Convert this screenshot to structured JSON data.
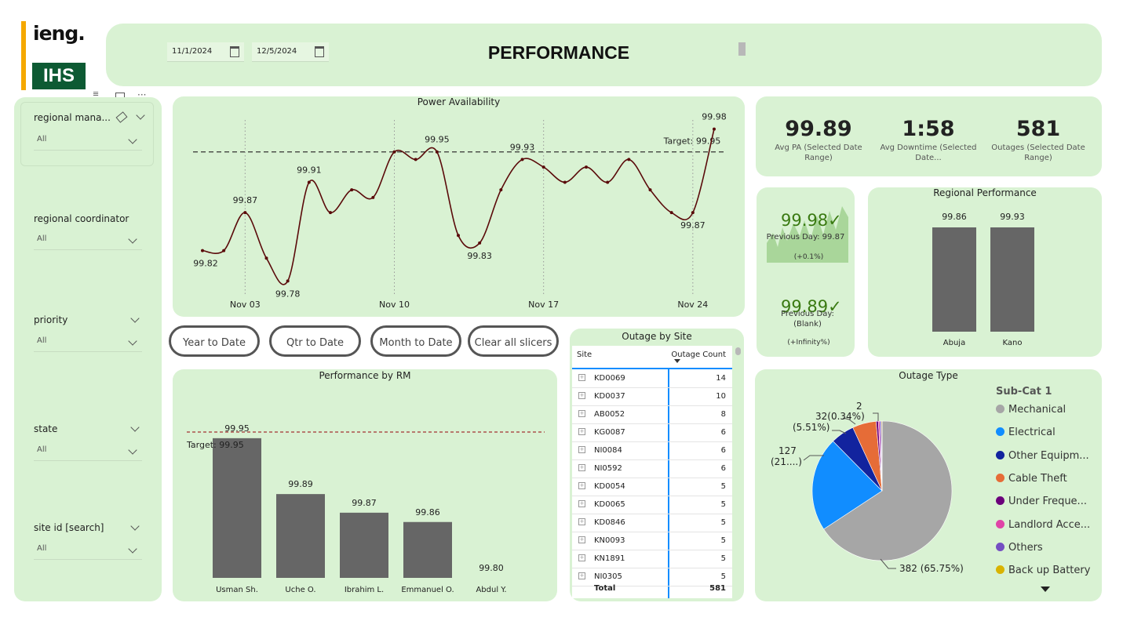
{
  "header": {
    "logo_top": "ieng.",
    "logo_bottom": "IHS",
    "title": "PERFORMANCE",
    "date_from": "11/1/2024",
    "date_to": "12/5/2024"
  },
  "slicers": [
    {
      "label": "regional mana...",
      "value": "All"
    },
    {
      "label": "regional coordinator",
      "value": "All"
    },
    {
      "label": "priority",
      "value": "All"
    },
    {
      "label": "state",
      "value": "All"
    },
    {
      "label": "site id [search]",
      "value": "All"
    }
  ],
  "buttons": {
    "ytd": "Year to Date",
    "qtd": "Qtr to Date",
    "mtd": "Month to Date",
    "clear": "Clear all slicers"
  },
  "kpis": [
    {
      "value": "99.89",
      "label": "Avg PA (Selected Date Range)"
    },
    {
      "value": "1:58",
      "label": "Avg Downtime (Selected Date..."
    },
    {
      "value": "581",
      "label": "Outages (Selected Date Range)"
    }
  ],
  "daily_cards": [
    {
      "value": "99.98✓",
      "prev": "Previous Day: 99.87",
      "delta": "(+0.1%)"
    },
    {
      "value": "99.89✓",
      "prev": "Previous Day: (Blank)",
      "delta": "(+Infinity%)"
    }
  ],
  "colors": {
    "panel_bg": "#d9f2d3",
    "bar": "#666666",
    "line": "#5a0a0a",
    "target_line_pa": "#333333",
    "target_line_rm": "#a33333",
    "kpi_positive": "#3a7a12"
  },
  "chart_data": [
    {
      "type": "line",
      "title": "Power Availability",
      "x_ticks": [
        "Nov 03",
        "Nov 10",
        "Nov 17",
        "Nov 24"
      ],
      "target_label": "Target: 99.95",
      "target": 99.95,
      "ylim": [
        99.77,
        99.99
      ],
      "x": [
        1,
        2,
        3,
        4,
        5,
        6,
        7,
        8,
        9,
        10,
        11,
        12,
        13,
        14,
        15,
        16,
        17,
        18,
        19,
        20,
        21,
        22,
        23,
        24,
        25
      ],
      "values": [
        99.82,
        99.82,
        99.87,
        99.81,
        99.78,
        99.91,
        99.87,
        99.9,
        99.89,
        99.95,
        99.94,
        99.95,
        99.84,
        99.83,
        99.9,
        99.94,
        99.93,
        99.91,
        99.93,
        99.91,
        99.94,
        99.9,
        99.87,
        99.87,
        99.98
      ],
      "point_labels": [
        {
          "i": 0,
          "text": "99.82",
          "pos": "below"
        },
        {
          "i": 2,
          "text": "99.87",
          "pos": "above"
        },
        {
          "i": 4,
          "text": "99.78",
          "pos": "below"
        },
        {
          "i": 5,
          "text": "99.91",
          "pos": "above"
        },
        {
          "i": 11,
          "text": "99.95",
          "pos": "above"
        },
        {
          "i": 13,
          "text": "99.83",
          "pos": "below"
        },
        {
          "i": 15,
          "text": "99.93",
          "pos": "above"
        },
        {
          "i": 23,
          "text": "99.87",
          "pos": "below"
        },
        {
          "i": 24,
          "text": "99.98",
          "pos": "above"
        }
      ]
    },
    {
      "type": "bar",
      "title": "Regional Performance",
      "categories": [
        "Abuja",
        "Kano"
      ],
      "values": [
        99.86,
        99.93
      ]
    },
    {
      "type": "bar",
      "title": "Performance by RM",
      "categories": [
        "Usman Sh.",
        "Uche O.",
        "Ibrahim L.",
        "Emmanuel O.",
        "Abdul Y."
      ],
      "values": [
        99.95,
        99.89,
        99.87,
        99.86,
        99.8
      ],
      "target": 99.95,
      "target_label": "Target: 99.95",
      "ylim": [
        99.8,
        99.96
      ]
    },
    {
      "type": "table",
      "title": "Outage by Site",
      "columns": [
        "Site",
        "Outage Count"
      ],
      "rows": [
        [
          "KD0069",
          "14"
        ],
        [
          "KD0037",
          "10"
        ],
        [
          "AB0052",
          "8"
        ],
        [
          "KG0087",
          "6"
        ],
        [
          "NI0084",
          "6"
        ],
        [
          "NI0592",
          "6"
        ],
        [
          "KD0054",
          "5"
        ],
        [
          "KD0065",
          "5"
        ],
        [
          "KD0846",
          "5"
        ],
        [
          "KN0093",
          "5"
        ],
        [
          "KN1891",
          "5"
        ],
        [
          "NI0305",
          "5"
        ]
      ],
      "total_label": "Total",
      "total_value": "581"
    },
    {
      "type": "pie",
      "title": "Outage Type",
      "legend_title": "Sub-Cat 1",
      "slices": [
        {
          "name": "Mechanical",
          "value": 382,
          "color": "#a6a6a6"
        },
        {
          "name": "Electrical",
          "value": 127,
          "color": "#118dff"
        },
        {
          "name": "Other Equipm...",
          "value": 32,
          "color": "#12239e"
        },
        {
          "name": "Cable Theft",
          "value": 32,
          "color": "#e66c37"
        },
        {
          "name": "Under Freque...",
          "value": 3,
          "color": "#6b007b"
        },
        {
          "name": "Landlord Acce...",
          "value": 2,
          "color": "#e044a7"
        },
        {
          "name": "Others",
          "value": 2,
          "color": "#744ec2"
        },
        {
          "name": "Back up Battery",
          "value": 1,
          "color": "#d9b300"
        }
      ],
      "annotations": [
        "382 (65.75%)",
        "127",
        "(21....)",
        "(5.51%)",
        "32(0.34%)",
        "2"
      ]
    }
  ]
}
